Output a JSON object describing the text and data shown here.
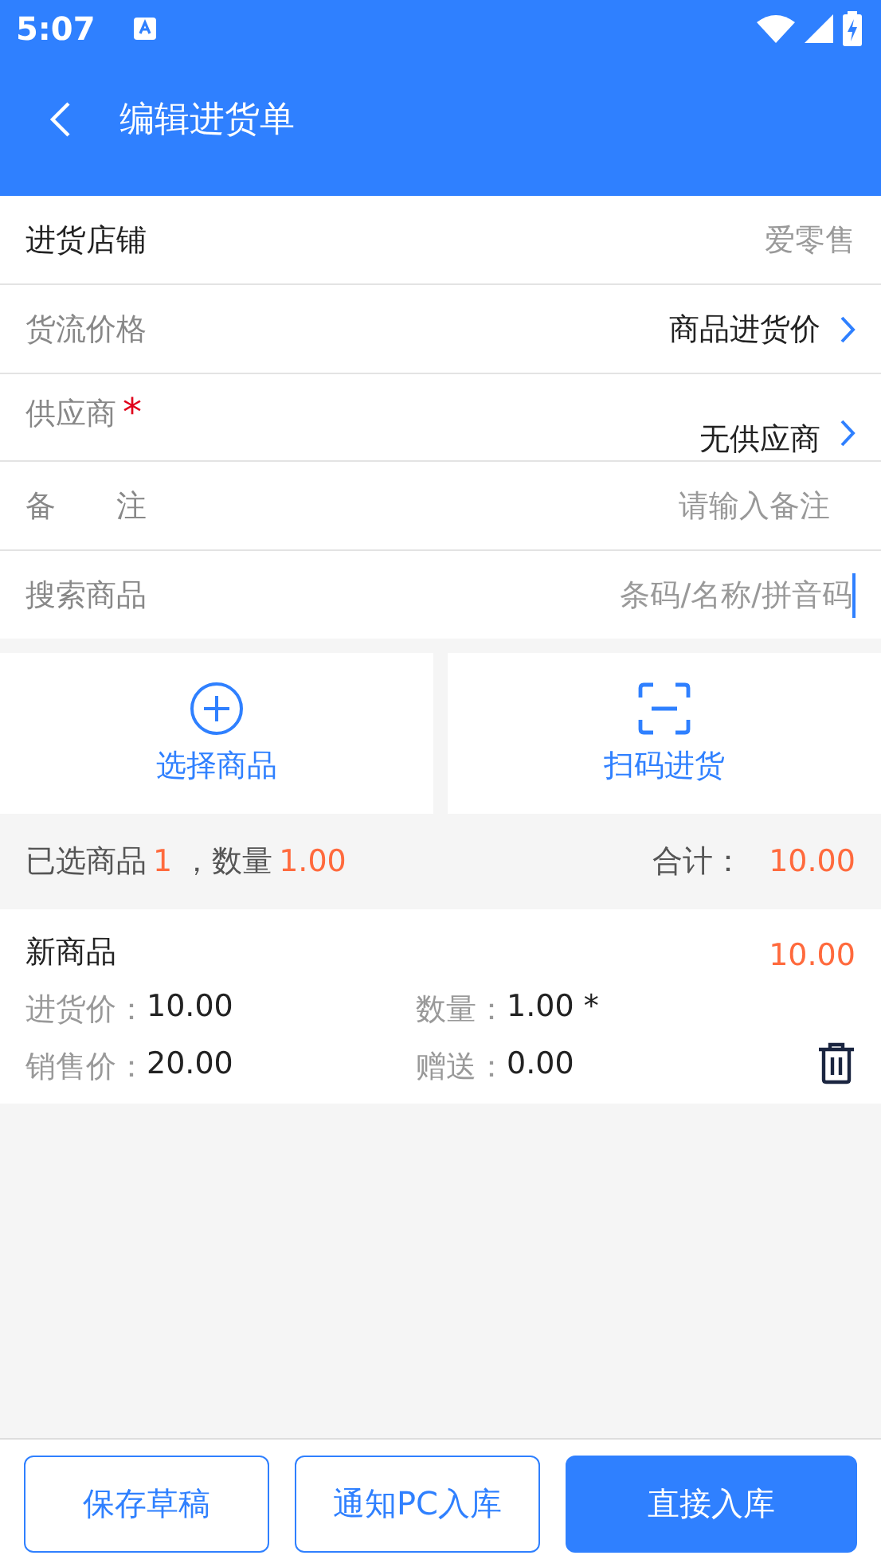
{
  "status_bar": {
    "time": "5:07"
  },
  "header": {
    "title": "编辑进货单"
  },
  "form": [
    {
      "kind": "text",
      "label": "进货店铺",
      "value": "爱零售"
    },
    {
      "kind": "select",
      "label": "货流价格",
      "value": "商品进货价"
    },
    {
      "kind": "select",
      "label": "供应商",
      "value": "无供应商",
      "required_mark": "*"
    },
    {
      "kind": "input",
      "label": "备　　注",
      "placeholder": "请输入备注"
    },
    {
      "kind": "search",
      "label": "搜索商品",
      "placeholder": "条码/名称/拼音码"
    }
  ],
  "actions": [
    {
      "kind": "add",
      "label": "选择商品"
    },
    {
      "kind": "scan",
      "label": "扫码进货"
    }
  ],
  "summary": {
    "selected_label": "已选商品",
    "selected_count": "1",
    "quantity_label": "，数量",
    "quantity": "1.00",
    "total_label": "合计：",
    "total": "10.00"
  },
  "items": [
    {
      "name": "新商品",
      "amount": "10.00",
      "fields": [
        {
          "label": "进货价：",
          "value": "10.00"
        },
        {
          "label": "数量：",
          "value": "1.00 *"
        },
        {
          "label": "销售价：",
          "value": "20.00"
        },
        {
          "label": "赠送：",
          "value": "0.00"
        }
      ]
    }
  ],
  "buttons": [
    {
      "label": "保存草稿",
      "kind": "outline"
    },
    {
      "label": "通知PC入库",
      "kind": "outline"
    },
    {
      "label": "直接入库",
      "kind": "primary"
    }
  ]
}
